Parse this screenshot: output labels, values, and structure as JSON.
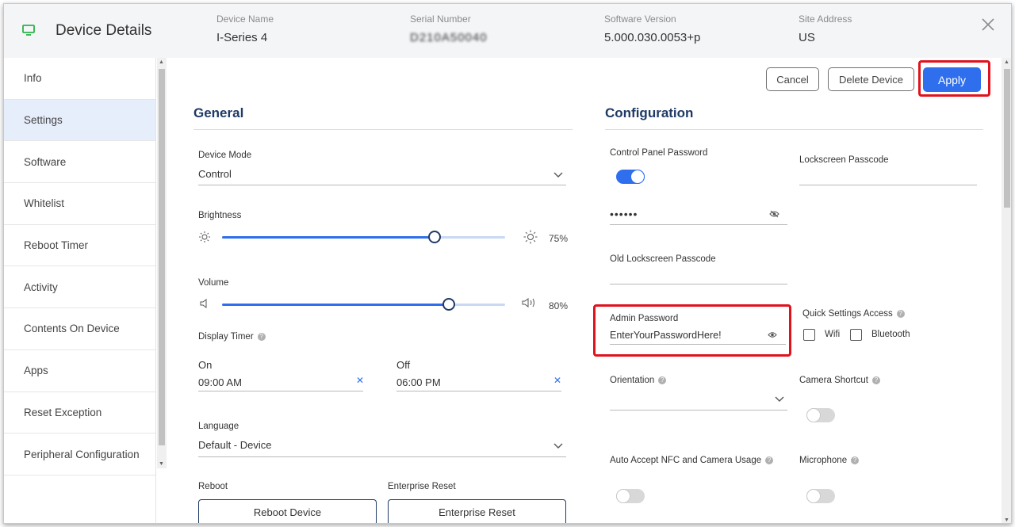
{
  "header": {
    "title": "Device Details",
    "device_name_label": "Device Name",
    "device_name": "I-Series 4",
    "serial_label": "Serial Number",
    "serial": "D210A50040",
    "software_label": "Software Version",
    "software": "5.000.030.0053+p",
    "site_label": "Site Address",
    "site": "US"
  },
  "sidebar": {
    "items": [
      {
        "label": "Info"
      },
      {
        "label": "Settings"
      },
      {
        "label": "Software"
      },
      {
        "label": "Whitelist"
      },
      {
        "label": "Reboot Timer"
      },
      {
        "label": "Activity"
      },
      {
        "label": "Contents On Device"
      },
      {
        "label": "Apps"
      },
      {
        "label": "Reset Exception"
      },
      {
        "label": "Peripheral Configuration"
      }
    ],
    "active_index": 1
  },
  "actions": {
    "cancel": "Cancel",
    "delete": "Delete Device",
    "apply": "Apply"
  },
  "general": {
    "title": "General",
    "device_mode_label": "Device Mode",
    "device_mode_value": "Control",
    "brightness_label": "Brightness",
    "brightness_value": 75,
    "brightness_pct": "75%",
    "volume_label": "Volume",
    "volume_value": 80,
    "volume_pct": "80%",
    "display_timer_label": "Display Timer",
    "on_label": "On",
    "on_value": "09:00 AM",
    "off_label": "Off",
    "off_value": "06:00 PM",
    "language_label": "Language",
    "language_value": "Default - Device",
    "reboot_label": "Reboot",
    "reboot_button": "Reboot Device",
    "enterprise_label": "Enterprise Reset",
    "enterprise_button": "Enterprise Reset"
  },
  "configuration": {
    "title": "Configuration",
    "cp_password_label": "Control Panel Password",
    "cp_password_enabled": true,
    "cp_password_value": "••••••",
    "lockscreen_label": "Lockscreen Passcode",
    "old_lockscreen_label": "Old Lockscreen Passcode",
    "admin_password_label": "Admin Password",
    "admin_password_value": "EnterYourPasswordHere!",
    "quick_settings_label": "Quick Settings Access",
    "wifi_label": "Wifi",
    "wifi_checked": false,
    "bluetooth_label": "Bluetooth",
    "bluetooth_checked": false,
    "orientation_label": "Orientation",
    "camera_shortcut_label": "Camera Shortcut",
    "camera_shortcut_enabled": false,
    "nfc_label": "Auto Accept NFC and Camera Usage",
    "nfc_enabled": false,
    "microphone_label": "Microphone",
    "microphone_enabled": false
  },
  "colors": {
    "accent": "#2f6fed",
    "highlight": "#e0131d",
    "heading": "#1f3a66",
    "active_nav": "#e7eefb"
  }
}
